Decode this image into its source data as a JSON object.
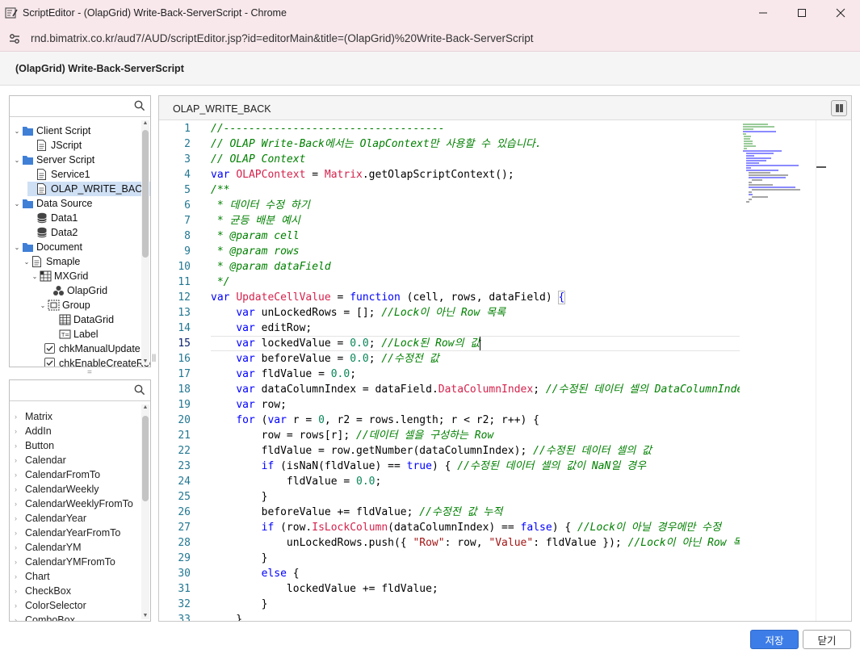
{
  "window": {
    "title": "ScriptEditor - (OlapGrid) Write-Back-ServerScript - Chrome",
    "url": "rnd.bimatrix.co.kr/aud7/AUD/scriptEditor.jsp?id=editorMain&title=(OlapGrid)%20Write-Back-ServerScript"
  },
  "dialog": {
    "title": "(OlapGrid) Write-Back-ServerScript"
  },
  "tree": {
    "search_placeholder": "",
    "items": [
      {
        "label": "Client Script",
        "icon": "folder-icon"
      },
      {
        "label": "JScript",
        "icon": "document-icon"
      },
      {
        "label": "Server Script",
        "icon": "folder-icon"
      },
      {
        "label": "Service1",
        "icon": "document-icon"
      },
      {
        "label": "OLAP_WRITE_BACK",
        "icon": "document-icon"
      },
      {
        "label": "Data Source",
        "icon": "folder-icon"
      },
      {
        "label": "Data1",
        "icon": "database-icon"
      },
      {
        "label": "Data2",
        "icon": "database-icon"
      },
      {
        "label": "Document",
        "icon": "folder-icon"
      },
      {
        "label": "Smaple",
        "icon": "document-icon"
      },
      {
        "label": "MXGrid",
        "icon": "mxgrid-icon"
      },
      {
        "label": "OlapGrid",
        "icon": "olapgrid-icon"
      },
      {
        "label": "Group",
        "icon": "group-icon"
      },
      {
        "label": "DataGrid",
        "icon": "datagrid-icon"
      },
      {
        "label": "Label",
        "icon": "label-icon"
      },
      {
        "label": "chkManualUpdate",
        "icon": "checkbox-icon"
      },
      {
        "label": "chkEnableCreateRec",
        "icon": "checkbox-icon"
      }
    ]
  },
  "functions": {
    "search_placeholder": "",
    "items": [
      "Matrix",
      "AddIn",
      "Button",
      "Calendar",
      "CalendarFromTo",
      "CalendarWeekly",
      "CalendarWeeklyFromTo",
      "CalendarYear",
      "CalendarYearFromTo",
      "CalendarYM",
      "CalendarYMFromTo",
      "Chart",
      "CheckBox",
      "ColorSelector",
      "ComboBox"
    ]
  },
  "editor": {
    "tab_title": "OLAP_WRITE_BACK",
    "current_line": 15,
    "lines": [
      {
        "n": "1",
        "t": [
          [
            "com",
            "//-----------------------------------"
          ]
        ]
      },
      {
        "n": "2",
        "t": [
          [
            "com",
            "// OLAP Write-Back에서는 OlapContext만 사용할 수 있습니다."
          ]
        ]
      },
      {
        "n": "3",
        "t": [
          [
            "com",
            "// OLAP Context"
          ]
        ]
      },
      {
        "n": "4",
        "t": [
          [
            "kw",
            "var "
          ],
          [
            "fn",
            "OLAPContext"
          ],
          [
            "",
            " = "
          ],
          [
            "fn",
            "Matrix"
          ],
          [
            "",
            ".getOlapScriptContext();"
          ]
        ]
      },
      {
        "n": "5",
        "t": [
          [
            "com",
            "/**"
          ]
        ]
      },
      {
        "n": "6",
        "t": [
          [
            "com",
            " * 데이터 수정 하기"
          ]
        ]
      },
      {
        "n": "7",
        "t": [
          [
            "com",
            " * 균등 배분 예시"
          ]
        ]
      },
      {
        "n": "8",
        "t": [
          [
            "com",
            " * @param cell"
          ]
        ]
      },
      {
        "n": "9",
        "t": [
          [
            "com",
            " * @param rows"
          ]
        ]
      },
      {
        "n": "10",
        "t": [
          [
            "com",
            " * @param dataField"
          ]
        ]
      },
      {
        "n": "11",
        "t": [
          [
            "com",
            " */"
          ]
        ]
      },
      {
        "n": "12",
        "t": [
          [
            "kw",
            "var "
          ],
          [
            "fn",
            "UpdateCellValue"
          ],
          [
            "",
            " = "
          ],
          [
            "kw",
            "function"
          ],
          [
            "",
            " (cell, rows, dataField) "
          ],
          [
            "brc",
            "{"
          ]
        ]
      },
      {
        "n": "13",
        "t": [
          [
            "",
            "    "
          ],
          [
            "kw",
            "var"
          ],
          [
            "",
            " unLockedRows = []; "
          ],
          [
            "com",
            "//Lock이 아닌 Row 목록"
          ]
        ]
      },
      {
        "n": "14",
        "t": [
          [
            "",
            "    "
          ],
          [
            "kw",
            "var"
          ],
          [
            "",
            " editRow;"
          ]
        ]
      },
      {
        "n": "15",
        "t": [
          [
            "",
            "    "
          ],
          [
            "kw",
            "var"
          ],
          [
            "",
            " lockedValue = "
          ],
          [
            "num",
            "0.0"
          ],
          [
            "",
            "; "
          ],
          [
            "com",
            "//Lock된 Row의 값"
          ]
        ]
      },
      {
        "n": "16",
        "t": [
          [
            "",
            "    "
          ],
          [
            "kw",
            "var"
          ],
          [
            "",
            " beforeValue = "
          ],
          [
            "num",
            "0.0"
          ],
          [
            "",
            "; "
          ],
          [
            "com",
            "//수정전 값"
          ]
        ]
      },
      {
        "n": "17",
        "t": [
          [
            "",
            "    "
          ],
          [
            "kw",
            "var"
          ],
          [
            "",
            " fldValue = "
          ],
          [
            "num",
            "0.0"
          ],
          [
            "",
            ";"
          ]
        ]
      },
      {
        "n": "18",
        "t": [
          [
            "",
            "    "
          ],
          [
            "kw",
            "var"
          ],
          [
            "",
            " dataColumnIndex = dataField."
          ],
          [
            "fn",
            "DataColumnIndex"
          ],
          [
            "",
            "; "
          ],
          [
            "com",
            "//수정된 데이터 셀의 DataColumnIndex"
          ]
        ]
      },
      {
        "n": "19",
        "t": [
          [
            "",
            "    "
          ],
          [
            "kw",
            "var"
          ],
          [
            "",
            " row;"
          ]
        ]
      },
      {
        "n": "20",
        "t": [
          [
            "",
            "    "
          ],
          [
            "kw",
            "for"
          ],
          [
            "",
            " ("
          ],
          [
            "kw",
            "var"
          ],
          [
            "",
            " r = "
          ],
          [
            "num",
            "0"
          ],
          [
            "",
            ", r2 = rows.length; r < r2; r++) {"
          ]
        ]
      },
      {
        "n": "21",
        "t": [
          [
            "",
            "        row = rows[r]; "
          ],
          [
            "com",
            "//데이터 셀을 구성하는 Row"
          ]
        ]
      },
      {
        "n": "22",
        "t": [
          [
            "",
            "        fldValue = row.getNumber(dataColumnIndex); "
          ],
          [
            "com",
            "//수정된 데이터 셀의 값"
          ]
        ]
      },
      {
        "n": "23",
        "t": [
          [
            "",
            "        "
          ],
          [
            "kw",
            "if"
          ],
          [
            "",
            " (isNaN(fldValue) == "
          ],
          [
            "kw",
            "true"
          ],
          [
            "",
            ") { "
          ],
          [
            "com",
            "//수정된 데이터 셀의 값이 NaN일 경우"
          ]
        ]
      },
      {
        "n": "24",
        "t": [
          [
            "",
            "            fldValue = "
          ],
          [
            "num",
            "0.0"
          ],
          [
            "",
            ";"
          ]
        ]
      },
      {
        "n": "25",
        "t": [
          [
            "",
            "        }"
          ]
        ]
      },
      {
        "n": "26",
        "t": [
          [
            "",
            "        beforeValue += fldValue; "
          ],
          [
            "com",
            "//수정전 값 누적"
          ]
        ]
      },
      {
        "n": "27",
        "t": [
          [
            "",
            "        "
          ],
          [
            "kw",
            "if"
          ],
          [
            "",
            " (row."
          ],
          [
            "fn",
            "IsLockColumn"
          ],
          [
            "",
            "(dataColumnIndex) == "
          ],
          [
            "kw",
            "false"
          ],
          [
            "",
            ") { "
          ],
          [
            "com",
            "//Lock이 아닐 경우에만 수정"
          ]
        ]
      },
      {
        "n": "28",
        "t": [
          [
            "",
            "            unLockedRows.push({ "
          ],
          [
            "str",
            "\"Row\""
          ],
          [
            "",
            ": row, "
          ],
          [
            "str",
            "\"Value\""
          ],
          [
            "",
            ": fldValue }); "
          ],
          [
            "com",
            "//Lock이 아닌 Row 목록"
          ]
        ]
      },
      {
        "n": "29",
        "t": [
          [
            "",
            "        }"
          ]
        ]
      },
      {
        "n": "30",
        "t": [
          [
            "",
            "        "
          ],
          [
            "kw",
            "else"
          ],
          [
            "",
            " {"
          ]
        ]
      },
      {
        "n": "31",
        "t": [
          [
            "",
            "            lockedValue += fldValue;"
          ]
        ]
      },
      {
        "n": "32",
        "t": [
          [
            "",
            "        }"
          ]
        ]
      },
      {
        "n": "33",
        "t": [
          [
            "",
            "    }"
          ]
        ]
      }
    ]
  },
  "footer": {
    "save_label": "저장",
    "close_label": "닫기"
  },
  "colors": {
    "accent": "#3d7de8",
    "titlebar": "#f8e8ec",
    "comment": "#008000",
    "keyword": "#0000ff",
    "identifier": "#d4224c",
    "number": "#098658",
    "string": "#a31515"
  }
}
